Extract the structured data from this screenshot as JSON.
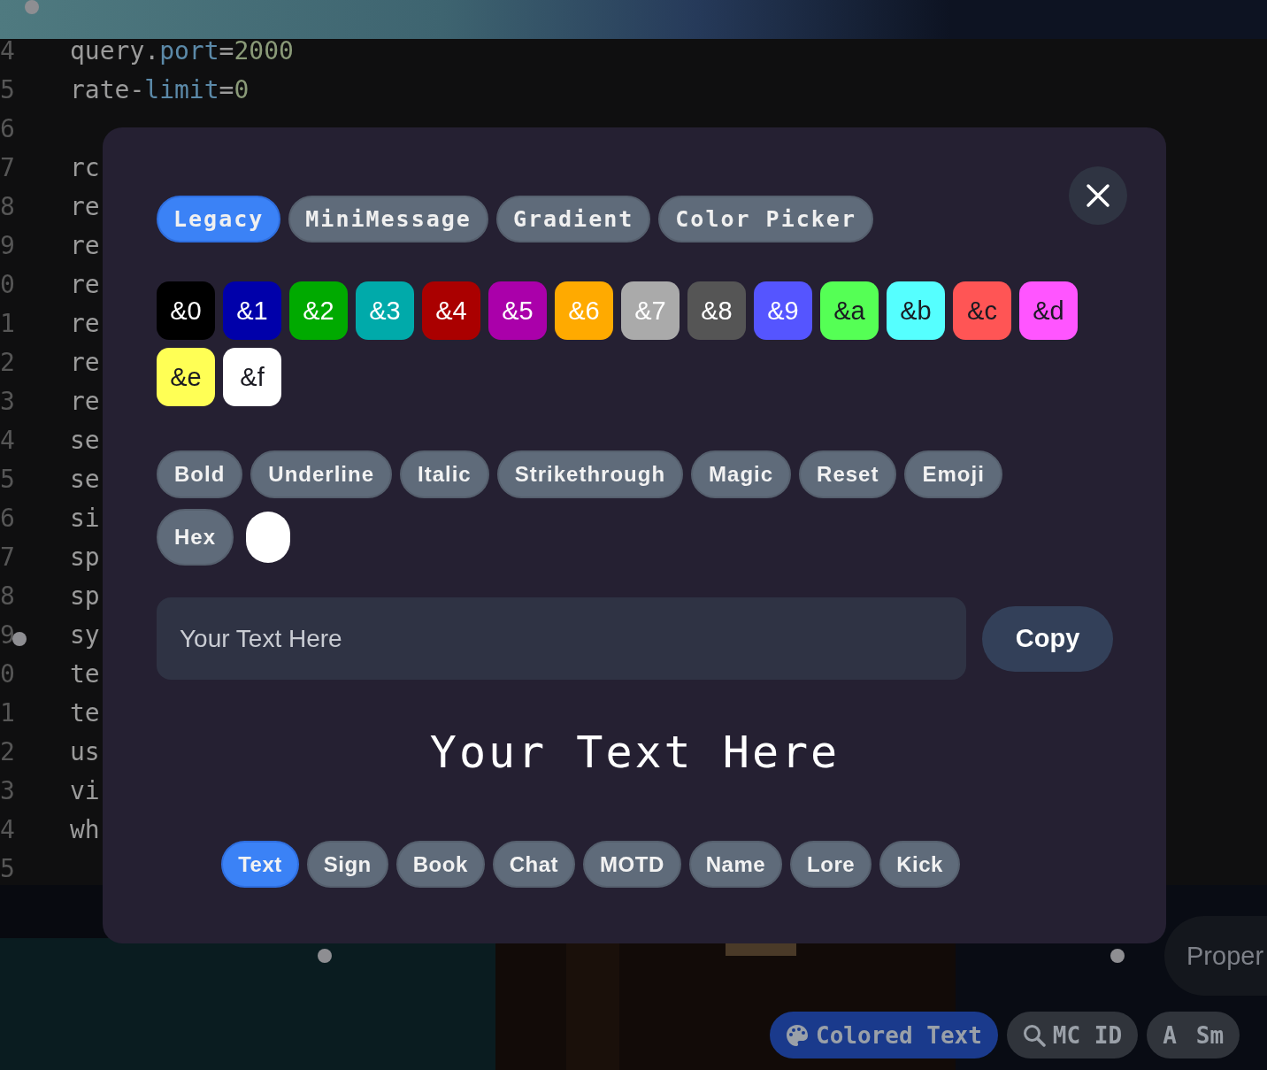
{
  "editor": {
    "lines": [
      {
        "number": "4",
        "segments": [
          {
            "text": "query.",
            "kind": "plain"
          },
          {
            "text": "port",
            "kind": "key"
          },
          {
            "text": "=",
            "kind": "plain"
          },
          {
            "text": "2000",
            "kind": "value"
          }
        ]
      },
      {
        "number": "5",
        "segments": [
          {
            "text": "rate-",
            "kind": "plain"
          },
          {
            "text": "limit",
            "kind": "key"
          },
          {
            "text": "=",
            "kind": "plain"
          },
          {
            "text": "0",
            "kind": "value"
          }
        ]
      },
      {
        "number": "6"
      },
      {
        "number": "7",
        "segments": [
          {
            "text": "rc",
            "kind": "plain"
          }
        ]
      },
      {
        "number": "8",
        "segments": [
          {
            "text": "re",
            "kind": "plain"
          }
        ]
      },
      {
        "number": "9",
        "segments": [
          {
            "text": "re",
            "kind": "plain"
          }
        ]
      },
      {
        "number": "0",
        "segments": [
          {
            "text": "re",
            "kind": "plain"
          }
        ]
      },
      {
        "number": "1",
        "segments": [
          {
            "text": "re",
            "kind": "plain"
          }
        ]
      },
      {
        "number": "2",
        "segments": [
          {
            "text": "re",
            "kind": "plain"
          }
        ]
      },
      {
        "number": "3",
        "segments": [
          {
            "text": "re",
            "kind": "plain"
          }
        ]
      },
      {
        "number": "4",
        "segments": [
          {
            "text": "se",
            "kind": "plain"
          }
        ]
      },
      {
        "number": "5",
        "segments": [
          {
            "text": "se",
            "kind": "plain"
          }
        ]
      },
      {
        "number": "6",
        "segments": [
          {
            "text": "si",
            "kind": "plain"
          }
        ]
      },
      {
        "number": "7",
        "segments": [
          {
            "text": "sp",
            "kind": "plain"
          }
        ]
      },
      {
        "number": "8",
        "segments": [
          {
            "text": "sp",
            "kind": "plain"
          }
        ]
      },
      {
        "number": "9",
        "segments": [
          {
            "text": "sy",
            "kind": "plain"
          }
        ]
      },
      {
        "number": "0",
        "segments": [
          {
            "text": "te",
            "kind": "plain"
          }
        ]
      },
      {
        "number": "1",
        "segments": [
          {
            "text": "te",
            "kind": "plain"
          }
        ]
      },
      {
        "number": "2",
        "segments": [
          {
            "text": "us",
            "kind": "plain"
          }
        ]
      },
      {
        "number": "3",
        "segments": [
          {
            "text": "vi",
            "kind": "plain"
          }
        ]
      },
      {
        "number": "4",
        "segments": [
          {
            "text": "wh",
            "kind": "plain"
          }
        ]
      },
      {
        "number": "5"
      }
    ]
  },
  "modal": {
    "format_tabs": [
      {
        "label": "Legacy",
        "selected": true
      },
      {
        "label": "MiniMessage",
        "selected": false
      },
      {
        "label": "Gradient",
        "selected": false
      },
      {
        "label": "Color Picker",
        "selected": false
      }
    ],
    "color_codes": [
      {
        "label": "&0",
        "color": "#000000",
        "dark_text": false
      },
      {
        "label": "&1",
        "color": "#0000aa",
        "dark_text": false
      },
      {
        "label": "&2",
        "color": "#00aa00",
        "dark_text": false
      },
      {
        "label": "&3",
        "color": "#00aaaa",
        "dark_text": false
      },
      {
        "label": "&4",
        "color": "#aa0000",
        "dark_text": false
      },
      {
        "label": "&5",
        "color": "#aa00aa",
        "dark_text": false
      },
      {
        "label": "&6",
        "color": "#ffaa00",
        "dark_text": false
      },
      {
        "label": "&7",
        "color": "#aaaaaa",
        "dark_text": false
      },
      {
        "label": "&8",
        "color": "#555555",
        "dark_text": false
      },
      {
        "label": "&9",
        "color": "#5555ff",
        "dark_text": false
      },
      {
        "label": "&a",
        "color": "#55ff55",
        "dark_text": true
      },
      {
        "label": "&b",
        "color": "#55ffff",
        "dark_text": true
      },
      {
        "label": "&c",
        "color": "#ff5555",
        "dark_text": true
      },
      {
        "label": "&d",
        "color": "#ff55ff",
        "dark_text": true
      },
      {
        "label": "&e",
        "color": "#ffff55",
        "dark_text": true
      },
      {
        "label": "&f",
        "color": "#ffffff",
        "dark_text": true
      }
    ],
    "style_buttons": [
      "Bold",
      "Underline",
      "Italic",
      "Strikethrough",
      "Magic",
      "Reset",
      "Emoji",
      "Hex"
    ],
    "hex_swatch": {
      "color": "#ffffff"
    },
    "input": {
      "placeholder": "Your Text Here"
    },
    "copy_button": "Copy",
    "preview": "Your Text Here",
    "target_tabs": [
      {
        "label": "Text",
        "selected": true
      },
      {
        "label": "Sign",
        "selected": false
      },
      {
        "label": "Book",
        "selected": false
      },
      {
        "label": "Chat",
        "selected": false
      },
      {
        "label": "MOTD",
        "selected": false
      },
      {
        "label": "Name",
        "selected": false
      },
      {
        "label": "Lore",
        "selected": false
      },
      {
        "label": "Kick",
        "selected": false
      }
    ]
  },
  "side_pill": "Proper",
  "bottom_nav": [
    {
      "label": "Colored Text",
      "selected": true
    },
    {
      "label": "MC ID",
      "selected": false
    },
    {
      "label": "Sm",
      "icon_char": "A",
      "selected": false
    }
  ]
}
